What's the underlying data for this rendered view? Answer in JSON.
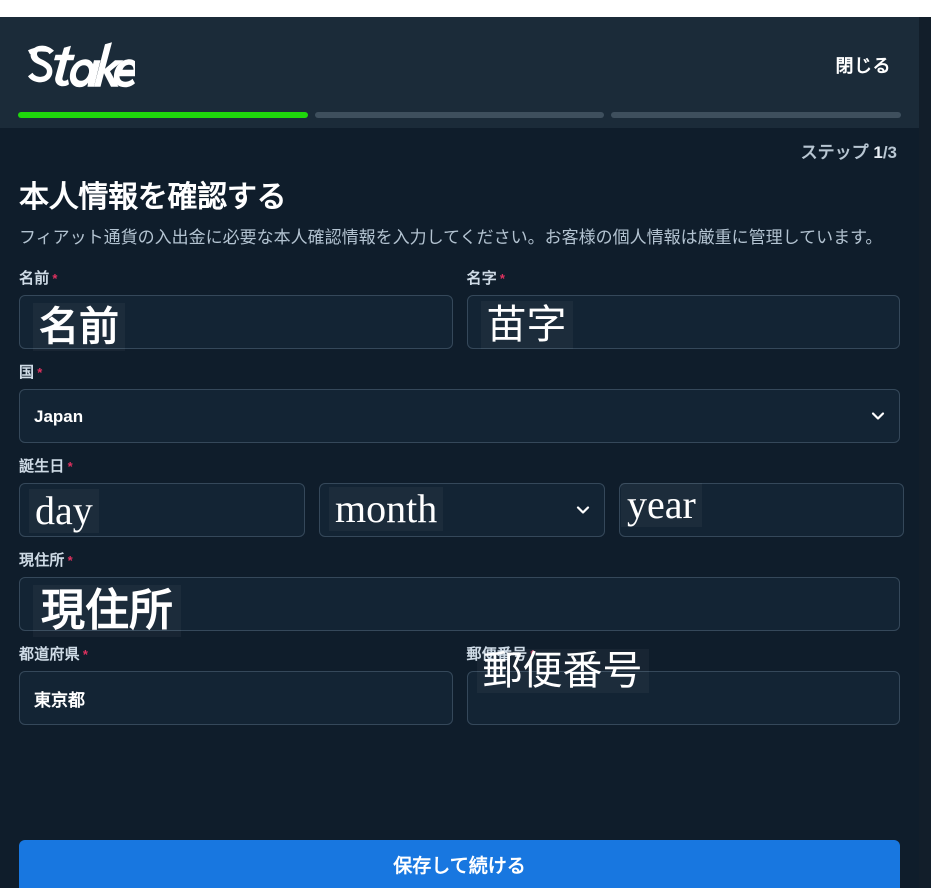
{
  "header": {
    "logo_text": "Stake",
    "logo_name": "stake-logo",
    "close_label": "閉じる"
  },
  "progress": {
    "segments": [
      {
        "state": "active"
      },
      {
        "state": "inactive"
      },
      {
        "state": "inactive"
      }
    ],
    "active_color": "#1fd70c",
    "inactive_color": "#3e4f5d",
    "step_prefix": "ステップ ",
    "step_current": "1",
    "step_suffix": "/3"
  },
  "main": {
    "title": "本人情報を確認する",
    "description": "フィアット通貨の入出金に必要な本人確認情報を入力してください。お客様の個人情報は厳重に管理しています。"
  },
  "form": {
    "required_marker": "*",
    "first_name": {
      "label": "名前",
      "value": "",
      "placeholder": "",
      "overlay": "名前"
    },
    "last_name": {
      "label": "名字",
      "value": "",
      "placeholder": "",
      "overlay": "苗字"
    },
    "country": {
      "label": "国",
      "selected": "Japan",
      "options": [
        "Japan"
      ],
      "chevron": "chevron-down-icon"
    },
    "birthday": {
      "label": "誕生日",
      "day": {
        "value": "",
        "placeholder": "",
        "overlay": "day"
      },
      "month": {
        "selected": "",
        "placeholder": "",
        "overlay": "month",
        "options": [
          ""
        ],
        "chevron": "chevron-down-icon"
      },
      "year": {
        "value": "",
        "placeholder": "",
        "overlay": "year"
      }
    },
    "address": {
      "label": "現住所",
      "value": "",
      "placeholder": "",
      "overlay": "現住所"
    },
    "prefecture": {
      "label": "都道府県",
      "value": "東京都",
      "placeholder": ""
    },
    "postal_code": {
      "label": "郵便番号",
      "value": "",
      "placeholder": "",
      "overlay": "郵便番号"
    }
  },
  "footer": {
    "save_label": "保存して続ける",
    "accent_color": "#1877e0"
  }
}
